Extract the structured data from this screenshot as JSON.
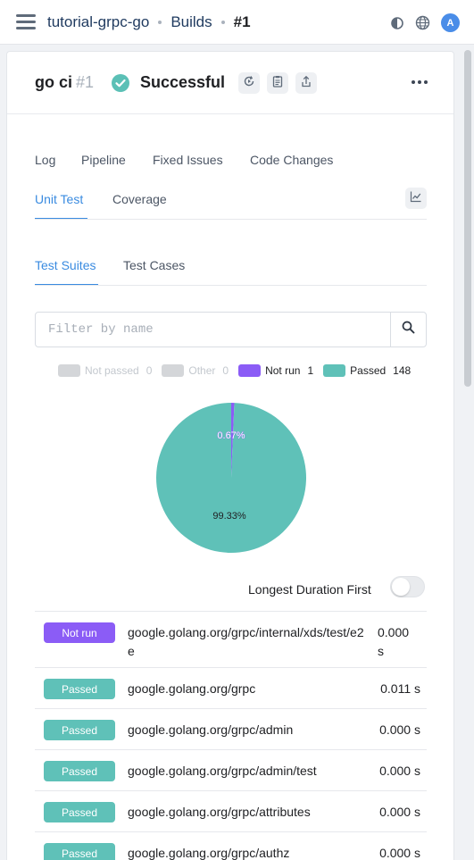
{
  "header": {
    "project": "tutorial-grpc-go",
    "section": "Builds",
    "build": "#1",
    "avatar_initial": "A"
  },
  "build": {
    "job": "go ci",
    "number": "#1",
    "status": "Successful",
    "status_color": "#5bc0b6",
    "actions": [
      "rebuild-icon",
      "clipboard-icon",
      "upload-icon"
    ]
  },
  "tabs": [
    "Log",
    "Pipeline",
    "Fixed Issues",
    "Code Changes"
  ],
  "subtabs": [
    "Unit Test",
    "Coverage"
  ],
  "active_subtab": "Unit Test",
  "subsubtabs": [
    "Test Suites",
    "Test Cases"
  ],
  "active_subsubtab": "Test Suites",
  "filter": {
    "placeholder": "Filter by name",
    "value": ""
  },
  "legend": [
    {
      "label": "Not passed",
      "count": "0",
      "color": "#c7c9cc",
      "enabled": false
    },
    {
      "label": "Other",
      "count": "0",
      "color": "#c7c9cc",
      "enabled": false
    },
    {
      "label": "Not run",
      "count": "1",
      "color": "#8b5cf6",
      "enabled": true
    },
    {
      "label": "Passed",
      "count": "148",
      "color": "#5fc1b8",
      "enabled": true
    }
  ],
  "chart_data": {
    "type": "pie",
    "slices": [
      {
        "name": "Not run",
        "value": 1,
        "percent_label": "0.67%",
        "color": "#8b5cf6"
      },
      {
        "name": "Passed",
        "value": 148,
        "percent_label": "99.33%",
        "color": "#5fc1b8"
      }
    ]
  },
  "sort_toggle": {
    "label": "Longest Duration First",
    "on": false
  },
  "suites": [
    {
      "status": "Not run",
      "name": "google.golang.org/grpc/internal/xds/test/e2e",
      "duration": "0.000 s"
    },
    {
      "status": "Passed",
      "name": "google.golang.org/grpc",
      "duration": "0.011 s"
    },
    {
      "status": "Passed",
      "name": "google.golang.org/grpc/admin",
      "duration": "0.000 s"
    },
    {
      "status": "Passed",
      "name": "google.golang.org/grpc/admin/test",
      "duration": "0.000 s"
    },
    {
      "status": "Passed",
      "name": "google.golang.org/grpc/attributes",
      "duration": "0.000 s"
    },
    {
      "status": "Passed",
      "name": "google.golang.org/grpc/authz",
      "duration": "0.000 s"
    }
  ],
  "status_colors": {
    "Not run": "#8b5cf6",
    "Passed": "#5fc1b8"
  }
}
